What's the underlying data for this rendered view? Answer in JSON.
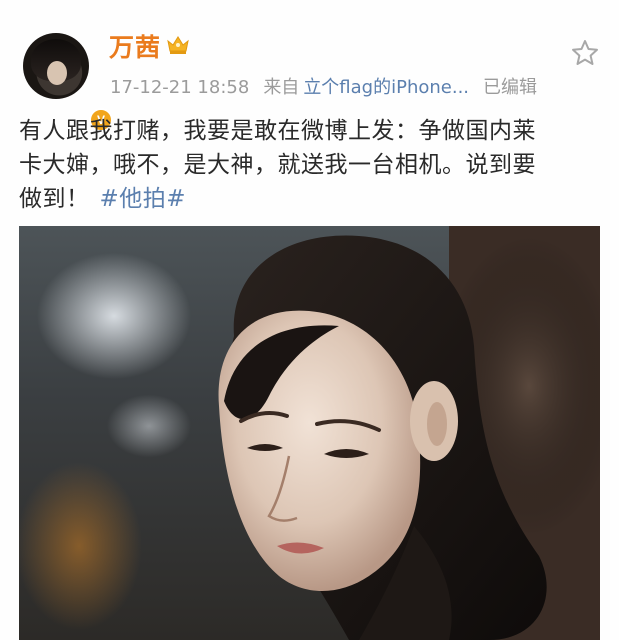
{
  "user": {
    "name": "万茜",
    "verified_mark": "V"
  },
  "meta": {
    "time": "17-12-21 18:58",
    "from_label": "来自",
    "source": "立个flag的iPhone...",
    "edited": "已编辑"
  },
  "post": {
    "lines": [
      "有人跟我打赌，我要是敢在微博上发：争做国内莱",
      "卡大婶，哦不，是大神，就送我一台相机。说到要",
      "做到！"
    ],
    "hashtag": "#他拍#"
  },
  "icons": {
    "crown": "crown-icon",
    "favorite": "star-icon",
    "verified": "verified-badge"
  },
  "colors": {
    "username": "#ea7b1d",
    "link": "#5b7fae",
    "meta": "#9b9b9b",
    "verified": "#f2a51b"
  }
}
